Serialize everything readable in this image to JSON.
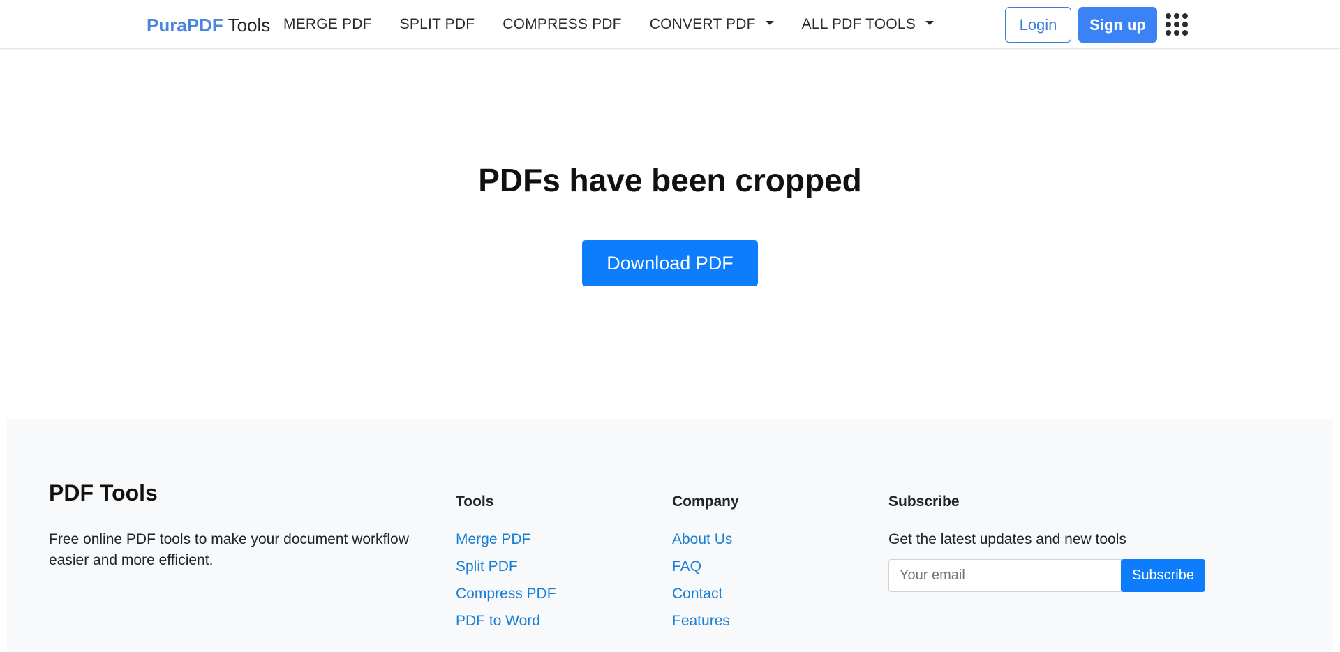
{
  "header": {
    "brand_accent": "PuraPDF",
    "brand_rest": "Tools",
    "nav": [
      {
        "label": "MERGE PDF"
      },
      {
        "label": "SPLIT PDF"
      },
      {
        "label": "COMPRESS PDF"
      },
      {
        "label": "CONVERT PDF",
        "dropdown": true
      },
      {
        "label": "ALL PDF TOOLS",
        "dropdown": true
      }
    ],
    "login_label": "Login",
    "signup_label": "Sign up",
    "apps_icon": "grid-dots-icon"
  },
  "main": {
    "title": "PDFs have been cropped",
    "download_label": "Download PDF"
  },
  "footer": {
    "brand_title": "PDF Tools",
    "description": "Free online PDF tools to make your document workflow easier and more efficient.",
    "tools": {
      "heading": "Tools",
      "links": [
        "Merge PDF",
        "Split PDF",
        "Compress PDF",
        "PDF to Word"
      ]
    },
    "company": {
      "heading": "Company",
      "links": [
        "About Us",
        "FAQ",
        "Contact",
        "Features"
      ]
    },
    "subscribe": {
      "heading": "Subscribe",
      "text": "Get the latest updates and new tools",
      "email_placeholder": "Your email",
      "email_value": "",
      "button_label": "Subscribe"
    }
  },
  "colors": {
    "brand_accent": "#4a86e0",
    "primary": "#0d7dfc",
    "signup_bg": "#3b82f6",
    "link": "#1a7fd4",
    "footer_bg": "#f8f9fa"
  }
}
